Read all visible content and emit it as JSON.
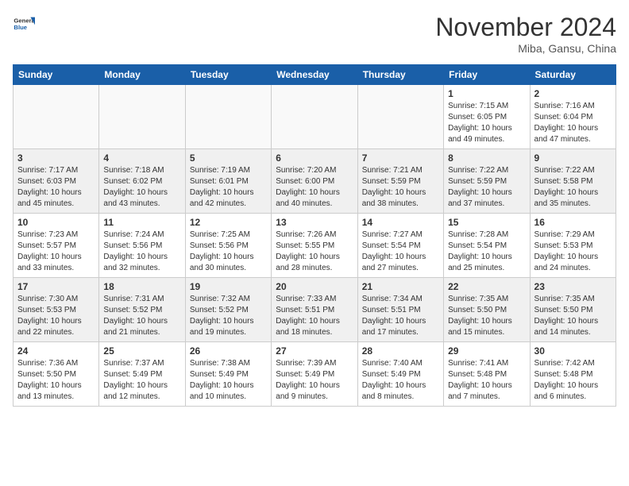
{
  "header": {
    "logo_line1": "General",
    "logo_line2": "Blue",
    "month": "November 2024",
    "location": "Miba, Gansu, China"
  },
  "days_of_week": [
    "Sunday",
    "Monday",
    "Tuesday",
    "Wednesday",
    "Thursday",
    "Friday",
    "Saturday"
  ],
  "weeks": [
    {
      "shade": false,
      "days": [
        {
          "date": "",
          "info": ""
        },
        {
          "date": "",
          "info": ""
        },
        {
          "date": "",
          "info": ""
        },
        {
          "date": "",
          "info": ""
        },
        {
          "date": "",
          "info": ""
        },
        {
          "date": "1",
          "info": "Sunrise: 7:15 AM\nSunset: 6:05 PM\nDaylight: 10 hours\nand 49 minutes."
        },
        {
          "date": "2",
          "info": "Sunrise: 7:16 AM\nSunset: 6:04 PM\nDaylight: 10 hours\nand 47 minutes."
        }
      ]
    },
    {
      "shade": true,
      "days": [
        {
          "date": "3",
          "info": "Sunrise: 7:17 AM\nSunset: 6:03 PM\nDaylight: 10 hours\nand 45 minutes."
        },
        {
          "date": "4",
          "info": "Sunrise: 7:18 AM\nSunset: 6:02 PM\nDaylight: 10 hours\nand 43 minutes."
        },
        {
          "date": "5",
          "info": "Sunrise: 7:19 AM\nSunset: 6:01 PM\nDaylight: 10 hours\nand 42 minutes."
        },
        {
          "date": "6",
          "info": "Sunrise: 7:20 AM\nSunset: 6:00 PM\nDaylight: 10 hours\nand 40 minutes."
        },
        {
          "date": "7",
          "info": "Sunrise: 7:21 AM\nSunset: 5:59 PM\nDaylight: 10 hours\nand 38 minutes."
        },
        {
          "date": "8",
          "info": "Sunrise: 7:22 AM\nSunset: 5:59 PM\nDaylight: 10 hours\nand 37 minutes."
        },
        {
          "date": "9",
          "info": "Sunrise: 7:22 AM\nSunset: 5:58 PM\nDaylight: 10 hours\nand 35 minutes."
        }
      ]
    },
    {
      "shade": false,
      "days": [
        {
          "date": "10",
          "info": "Sunrise: 7:23 AM\nSunset: 5:57 PM\nDaylight: 10 hours\nand 33 minutes."
        },
        {
          "date": "11",
          "info": "Sunrise: 7:24 AM\nSunset: 5:56 PM\nDaylight: 10 hours\nand 32 minutes."
        },
        {
          "date": "12",
          "info": "Sunrise: 7:25 AM\nSunset: 5:56 PM\nDaylight: 10 hours\nand 30 minutes."
        },
        {
          "date": "13",
          "info": "Sunrise: 7:26 AM\nSunset: 5:55 PM\nDaylight: 10 hours\nand 28 minutes."
        },
        {
          "date": "14",
          "info": "Sunrise: 7:27 AM\nSunset: 5:54 PM\nDaylight: 10 hours\nand 27 minutes."
        },
        {
          "date": "15",
          "info": "Sunrise: 7:28 AM\nSunset: 5:54 PM\nDaylight: 10 hours\nand 25 minutes."
        },
        {
          "date": "16",
          "info": "Sunrise: 7:29 AM\nSunset: 5:53 PM\nDaylight: 10 hours\nand 24 minutes."
        }
      ]
    },
    {
      "shade": true,
      "days": [
        {
          "date": "17",
          "info": "Sunrise: 7:30 AM\nSunset: 5:53 PM\nDaylight: 10 hours\nand 22 minutes."
        },
        {
          "date": "18",
          "info": "Sunrise: 7:31 AM\nSunset: 5:52 PM\nDaylight: 10 hours\nand 21 minutes."
        },
        {
          "date": "19",
          "info": "Sunrise: 7:32 AM\nSunset: 5:52 PM\nDaylight: 10 hours\nand 19 minutes."
        },
        {
          "date": "20",
          "info": "Sunrise: 7:33 AM\nSunset: 5:51 PM\nDaylight: 10 hours\nand 18 minutes."
        },
        {
          "date": "21",
          "info": "Sunrise: 7:34 AM\nSunset: 5:51 PM\nDaylight: 10 hours\nand 17 minutes."
        },
        {
          "date": "22",
          "info": "Sunrise: 7:35 AM\nSunset: 5:50 PM\nDaylight: 10 hours\nand 15 minutes."
        },
        {
          "date": "23",
          "info": "Sunrise: 7:35 AM\nSunset: 5:50 PM\nDaylight: 10 hours\nand 14 minutes."
        }
      ]
    },
    {
      "shade": false,
      "days": [
        {
          "date": "24",
          "info": "Sunrise: 7:36 AM\nSunset: 5:50 PM\nDaylight: 10 hours\nand 13 minutes."
        },
        {
          "date": "25",
          "info": "Sunrise: 7:37 AM\nSunset: 5:49 PM\nDaylight: 10 hours\nand 12 minutes."
        },
        {
          "date": "26",
          "info": "Sunrise: 7:38 AM\nSunset: 5:49 PM\nDaylight: 10 hours\nand 10 minutes."
        },
        {
          "date": "27",
          "info": "Sunrise: 7:39 AM\nSunset: 5:49 PM\nDaylight: 10 hours\nand 9 minutes."
        },
        {
          "date": "28",
          "info": "Sunrise: 7:40 AM\nSunset: 5:49 PM\nDaylight: 10 hours\nand 8 minutes."
        },
        {
          "date": "29",
          "info": "Sunrise: 7:41 AM\nSunset: 5:48 PM\nDaylight: 10 hours\nand 7 minutes."
        },
        {
          "date": "30",
          "info": "Sunrise: 7:42 AM\nSunset: 5:48 PM\nDaylight: 10 hours\nand 6 minutes."
        }
      ]
    }
  ]
}
